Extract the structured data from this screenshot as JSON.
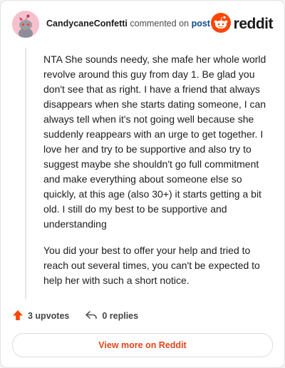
{
  "header": {
    "author": "CandycaneConfetti",
    "commented_on": "commented on",
    "post_link": "post",
    "logo_text": "reddit"
  },
  "comment": {
    "paragraphs": [
      "NTA She sounds needy, she mafe her whole world revolve around this guy from day 1. Be glad you don't see that as right. I have a friend that always disappears when she starts dating someone, I can always tell when it's not going well because she suddenly reappears with an urge to get together. I love her and try to be supportive and also try to suggest maybe she shouldn't go full commitment and make everything about someone else so quickly, at this age (also 30+) it starts getting a bit old. I still do my best to be supportive and understanding",
      "You did your best to offer your help and tried to reach out several times, you can't be expected to help her with such a short notice."
    ]
  },
  "actions": {
    "upvotes": "3 upvotes",
    "replies": "0 replies"
  },
  "footer": {
    "view_more": "View more on Reddit"
  },
  "icons": {
    "upvote": "upvote-arrow-icon",
    "reply": "reply-arrow-icon",
    "avatar": "snoo-avatar-icon",
    "logo": "reddit-logo-icon"
  },
  "colors": {
    "brand": "#ff4500",
    "link": "#0c4a8c",
    "view_more": "#e0461b"
  }
}
